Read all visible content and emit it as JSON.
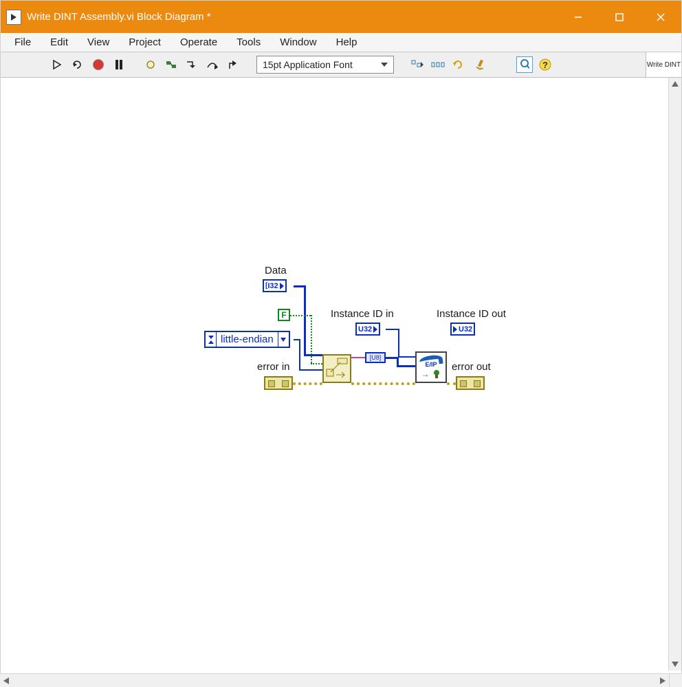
{
  "window": {
    "title": "Write DINT Assembly.vi Block Diagram *"
  },
  "menu": {
    "items": [
      "File",
      "Edit",
      "View",
      "Project",
      "Operate",
      "Tools",
      "Window",
      "Help"
    ]
  },
  "toolbar": {
    "font_label": "15pt Application Font",
    "conn_pane_text": "Write DINT"
  },
  "diagram": {
    "labels": {
      "data": "Data",
      "instance_in": "Instance ID in",
      "instance_out": "Instance ID out",
      "error_in": "error in",
      "error_out": "error out"
    },
    "terminals": {
      "data_type": "I32",
      "instance_in_type": "U32",
      "instance_out_type": "U32",
      "array_type": "[U8]"
    },
    "constants": {
      "bool_false": "F",
      "byte_order": "little-endian"
    },
    "nodes": {
      "eip_label": "E/IP"
    }
  }
}
